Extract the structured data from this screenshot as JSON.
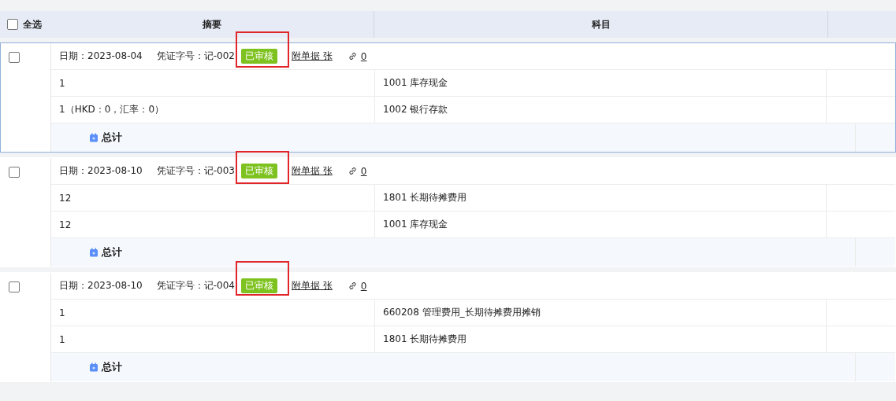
{
  "header": {
    "select_all": {
      "label": "全选",
      "checked": false
    },
    "columns": [
      "摘要",
      "科目"
    ]
  },
  "vouchers": [
    {
      "checked": false,
      "selected": true,
      "highlighted": true,
      "date": "日期：2023-08-04",
      "number": "凭证字号：记-002",
      "status": "已审核",
      "attachments": "附单据 张",
      "links": "0",
      "lines": [
        {
          "summary": "1",
          "account": "1001 库存现金"
        },
        {
          "summary": "1（HKD：0，汇率：0）",
          "account": "1002 银行存款"
        }
      ],
      "total": "总计"
    },
    {
      "checked": false,
      "selected": false,
      "highlighted": true,
      "date": "日期：2023-08-10",
      "number": "凭证字号：记-003",
      "status": "已审核",
      "attachments": "附单据 张",
      "links": "0",
      "lines": [
        {
          "summary": "12",
          "account": "1801 长期待摊费用"
        },
        {
          "summary": "12",
          "account": "1001 库存现金"
        }
      ],
      "total": "总计"
    },
    {
      "checked": false,
      "selected": false,
      "highlighted": true,
      "date": "日期：2023-08-10",
      "number": "凭证字号：记-004",
      "status": "已审核",
      "attachments": "附单据 张",
      "links": "0",
      "lines": [
        {
          "summary": "1",
          "account": "660208 管理费用_长期待摊费用摊销"
        },
        {
          "summary": "1",
          "account": "1801 长期待摊费用"
        }
      ],
      "total": "总计"
    }
  ]
}
